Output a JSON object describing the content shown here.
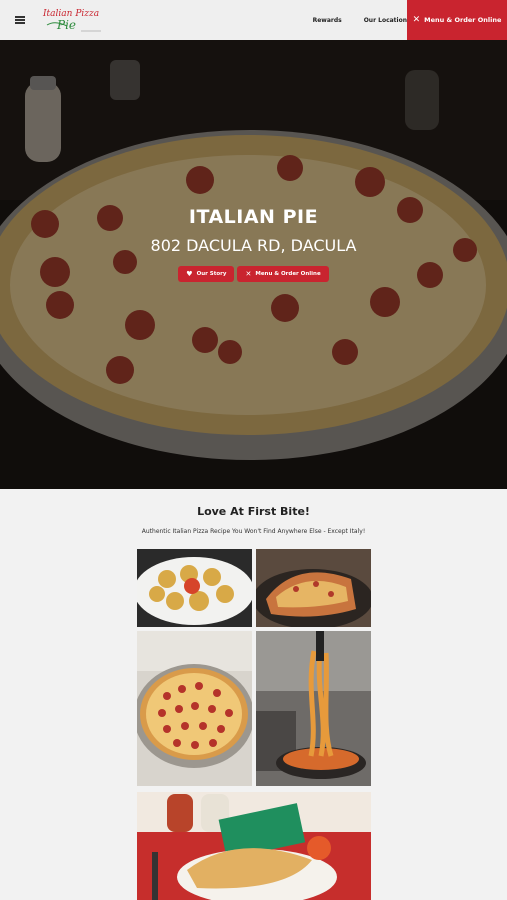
{
  "header": {
    "logo_line1": "Italian Pizza",
    "logo_line2": "Pie",
    "nav": [
      {
        "label": "Rewards"
      },
      {
        "label": "Our Location"
      }
    ],
    "order_button": "Menu & Order Online"
  },
  "hero": {
    "title": "ITALIAN PIE",
    "address": "802 DACULA RD, DACULA",
    "story_button": "Our Story",
    "order_button": "Menu & Order Online"
  },
  "section": {
    "title": "Love At First Bite!",
    "subtitle": "Authentic Italian Pizza Recipe You Won't Find Anywhere Else - Except Italy!"
  },
  "colors": {
    "brand_red": "#c9242f",
    "header_bg": "#efefef",
    "page_bg": "#f2f2f2"
  },
  "icons": [
    "menu-icon",
    "close-icon",
    "heart-icon"
  ]
}
